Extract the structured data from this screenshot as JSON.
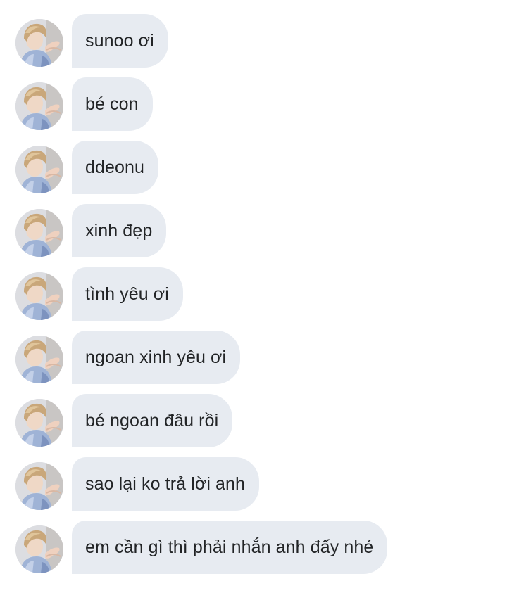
{
  "chat": {
    "messages": [
      {
        "text": "sunoo ơi"
      },
      {
        "text": "bé con"
      },
      {
        "text": "ddeonu"
      },
      {
        "text": "xinh đẹp"
      },
      {
        "text": "tình yêu ơi"
      },
      {
        "text": "ngoan xinh yêu ơi"
      },
      {
        "text": "bé ngoan đâu rồi"
      },
      {
        "text": "sao lại ko trả lời anh"
      },
      {
        "text": "em cần gì thì phải nhắn anh đấy nhé"
      }
    ]
  },
  "colors": {
    "bubble": "#e7ebf1",
    "text": "#222426",
    "background": "#ffffff"
  },
  "icons": {
    "avatar": "sender-avatar-photo"
  }
}
